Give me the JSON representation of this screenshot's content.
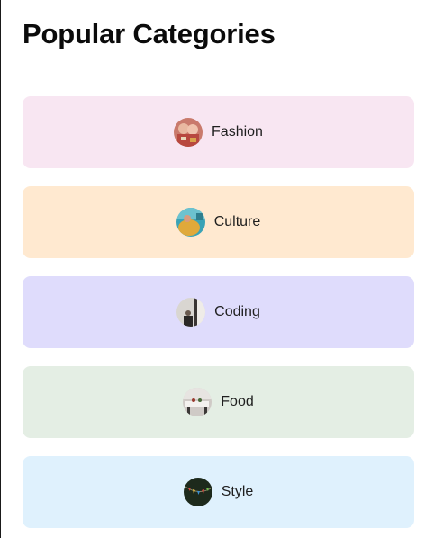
{
  "page": {
    "title": "Popular Categories"
  },
  "categories": [
    {
      "label": "Fashion",
      "bg": "#f8e6f2",
      "icon": "fashion-photo-icon"
    },
    {
      "label": "Culture",
      "bg": "#ffe9d0",
      "icon": "culture-photo-icon"
    },
    {
      "label": "Coding",
      "bg": "#dfdcfc",
      "icon": "coding-photo-icon"
    },
    {
      "label": "Food",
      "bg": "#e4eee4",
      "icon": "food-photo-icon"
    },
    {
      "label": "Style",
      "bg": "#dff1fd",
      "icon": "style-photo-icon"
    }
  ]
}
